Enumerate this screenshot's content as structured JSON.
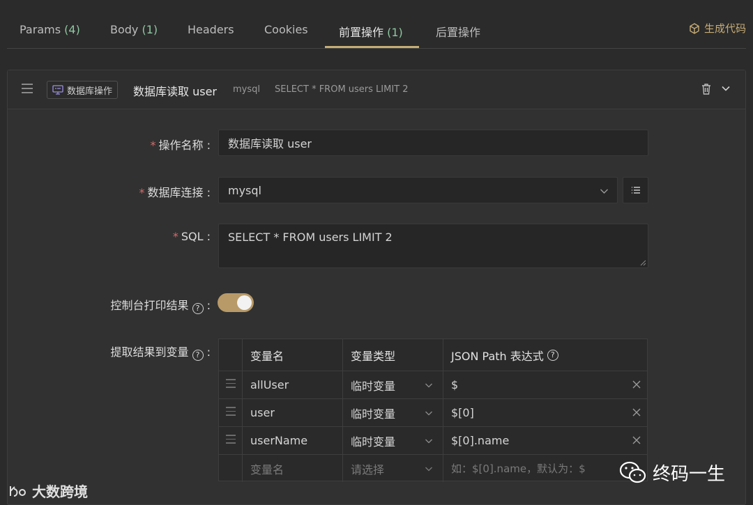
{
  "tabs": [
    {
      "label": "Params",
      "count": "(4)"
    },
    {
      "label": "Body",
      "count": "(1)"
    },
    {
      "label": "Headers",
      "count": ""
    },
    {
      "label": "Cookies",
      "count": ""
    },
    {
      "label": "前置操作",
      "count": "(1)"
    },
    {
      "label": "后置操作",
      "count": ""
    }
  ],
  "active_tab": "前置操作",
  "gen_code": "生成代码",
  "operation": {
    "tag": "数据库操作",
    "title": "数据库读取 user",
    "db": "mysql",
    "sql_preview": "SELECT * FROM users LIMIT 2"
  },
  "form": {
    "name_label": "操作名称",
    "name_value": "数据库读取 user",
    "db_label": "数据库连接",
    "db_value": "mysql",
    "sql_label": "SQL",
    "sql_value": "SELECT * FROM users LIMIT 2",
    "console_label": "控制台打印结果",
    "console_on": true,
    "extract_label": "提取结果到变量",
    "colon": ":"
  },
  "table": {
    "headers": [
      "变量名",
      "变量类型",
      "JSON Path 表达式"
    ],
    "rows": [
      {
        "name": "allUser",
        "type": "临时变量",
        "path": "$"
      },
      {
        "name": "user",
        "type": "临时变量",
        "path": "$[0]"
      },
      {
        "name": "userName",
        "type": "临时变量",
        "path": "$[0].name"
      }
    ],
    "placeholder": {
      "name": "变量名",
      "type": "请选择",
      "path": "如：$[0].name，默认为：$"
    }
  },
  "watermarks": {
    "left": "大数跨境",
    "right": "终码一生"
  },
  "colors": {
    "accent": "#c7ac76",
    "count": "#8fc7a1",
    "bg": "#2b2b2b"
  }
}
